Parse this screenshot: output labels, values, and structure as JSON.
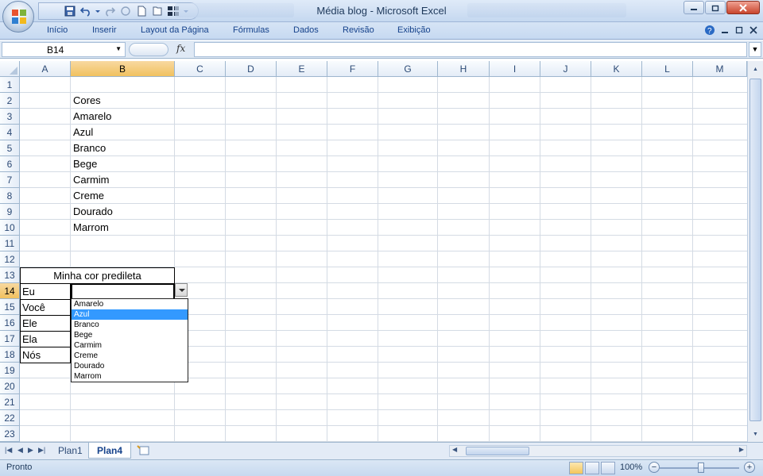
{
  "window": {
    "title": "Média blog - Microsoft Excel"
  },
  "ribbon": {
    "tabs": [
      "Início",
      "Inserir",
      "Layout da Página",
      "Fórmulas",
      "Dados",
      "Revisão",
      "Exibição"
    ]
  },
  "formula_bar": {
    "name_box": "B14",
    "fx_label": "fx",
    "formula": ""
  },
  "grid": {
    "columns": [
      "A",
      "B",
      "C",
      "D",
      "E",
      "F",
      "G",
      "H",
      "I",
      "J",
      "K",
      "L",
      "M"
    ],
    "rows": [
      "1",
      "2",
      "3",
      "4",
      "5",
      "6",
      "7",
      "8",
      "9",
      "10",
      "11",
      "12",
      "13",
      "14",
      "15",
      "16",
      "17",
      "18",
      "19",
      "20",
      "21",
      "22",
      "23"
    ],
    "selected_column": "B",
    "selected_row": "14",
    "cells": {
      "B2": "Cores",
      "B3": "Amarelo",
      "B4": "Azul",
      "B5": "Branco",
      "B6": "Bege",
      "B7": "Carmim",
      "B8": "Creme",
      "B9": "Dourado",
      "B10": "Marrom",
      "A13B13": "Minha cor predileta",
      "A14": "Eu",
      "A15": "Você",
      "A16": "Ele",
      "A17": "Ela",
      "A18": "Nós"
    }
  },
  "dropdown": {
    "options": [
      "Amarelo",
      "Azul",
      "Branco",
      "Bege",
      "Carmim",
      "Creme",
      "Dourado",
      "Marrom"
    ],
    "highlighted": "Azul"
  },
  "sheets": {
    "tabs": [
      "Plan1",
      "Plan4"
    ],
    "active": "Plan4"
  },
  "status": {
    "text": "Pronto",
    "zoom": "100%",
    "zoom_minus": "−",
    "zoom_plus": "+"
  },
  "colors": {
    "selection_header": "#f1c15f",
    "dropdown_highlight": "#3399ff",
    "ribbon_text": "#15428b"
  }
}
